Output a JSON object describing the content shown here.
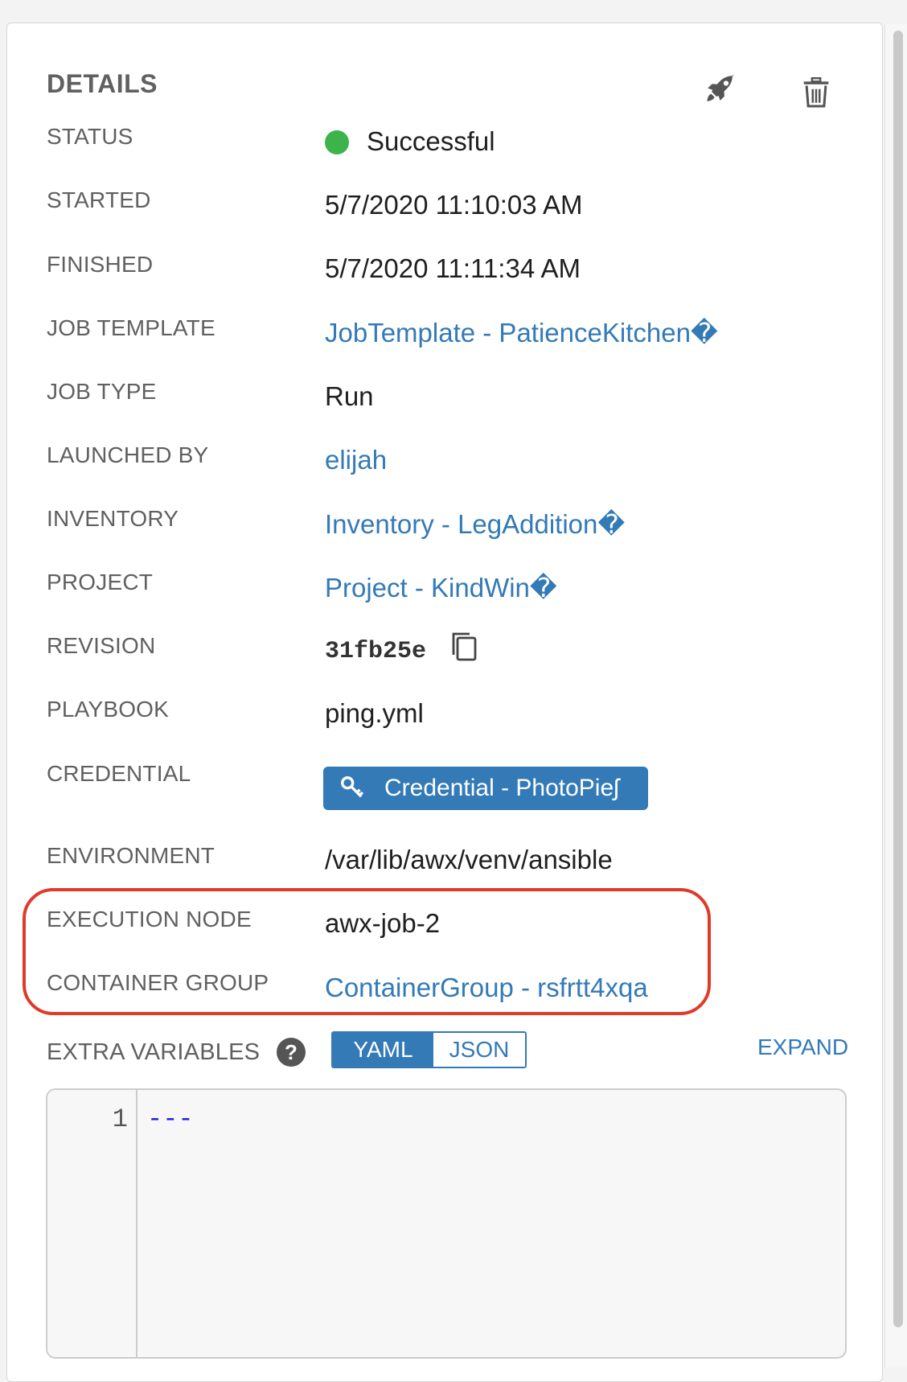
{
  "details": {
    "title": "DETAILS",
    "actions": {
      "launch_icon": "rocket-icon",
      "delete_icon": "trash-icon"
    },
    "fields": {
      "status": {
        "label": "STATUS",
        "value": "Successful",
        "color": "#3cb44b"
      },
      "started": {
        "label": "STARTED",
        "value": "5/7/2020 11:10:03 AM"
      },
      "finished": {
        "label": "FINISHED",
        "value": "5/7/2020 11:11:34 AM"
      },
      "job_template": {
        "label": "JOB TEMPLATE",
        "value": "JobTemplate - PatienceKitchen�"
      },
      "job_type": {
        "label": "JOB TYPE",
        "value": "Run"
      },
      "launched_by": {
        "label": "LAUNCHED BY",
        "value": "elijah"
      },
      "inventory": {
        "label": "INVENTORY",
        "value": "Inventory - LegAddition�"
      },
      "project": {
        "label": "PROJECT",
        "value": "Project - KindWin�"
      },
      "revision": {
        "label": "REVISION",
        "value": "31fb25e"
      },
      "playbook": {
        "label": "PLAYBOOK",
        "value": "ping.yml"
      },
      "credential": {
        "label": "CREDENTIAL",
        "value": "Credential - PhotoPieʃ"
      },
      "environment": {
        "label": "ENVIRONMENT",
        "value": "/var/lib/awx/venv/ansible"
      },
      "execution_node": {
        "label": "EXECUTION NODE",
        "value": "awx-job-2"
      },
      "container_group": {
        "label": "CONTAINER GROUP",
        "value": "ContainerGroup - rsfrtt4xqa"
      }
    },
    "extra_variables": {
      "label": "EXTRA VARIABLES",
      "toggle": {
        "yaml": "YAML",
        "json": "JSON",
        "selected": "YAML"
      },
      "expand": "EXPAND",
      "editor": {
        "lines": [
          {
            "number": "1",
            "text": "---"
          }
        ]
      }
    }
  },
  "colors": {
    "link": "#337ab7",
    "highlight": "#e03a2a",
    "success": "#3cb44b"
  }
}
